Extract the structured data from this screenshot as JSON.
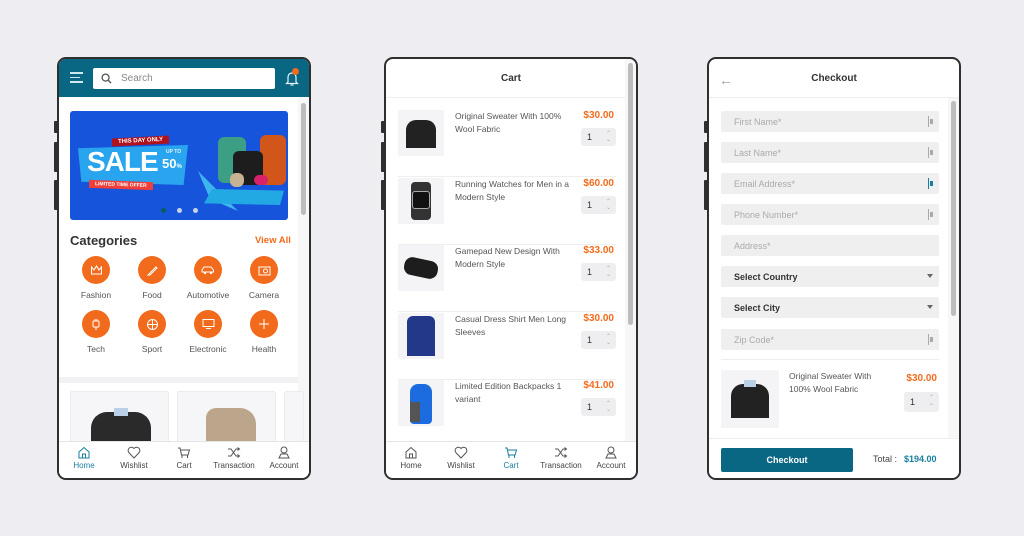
{
  "colors": {
    "primary": "#0a6783",
    "accent": "#f26b1d",
    "background": "#ededf2"
  },
  "home": {
    "search": {
      "placeholder": "Search",
      "icon": "search-icon"
    },
    "menu_icon": "menu-icon",
    "notification_icon": "bell-icon",
    "banner": {
      "tag": "THIS DAY ONLY",
      "headline": "SALE",
      "up_to": "UP TO",
      "discount": "50",
      "percent": "%",
      "sub": "LIMITED TIME OFFER",
      "active_slide": 1,
      "slide_count": 3
    },
    "categories_title": "Categories",
    "view_all": "View All",
    "categories": [
      {
        "label": "Fashion",
        "icon": "crown-icon"
      },
      {
        "label": "Food",
        "icon": "knife-icon"
      },
      {
        "label": "Automotive",
        "icon": "car-icon"
      },
      {
        "label": "Camera",
        "icon": "camera-icon"
      },
      {
        "label": "Tech",
        "icon": "plug-icon"
      },
      {
        "label": "Sport",
        "icon": "ball-icon"
      },
      {
        "label": "Electronic",
        "icon": "monitor-icon"
      },
      {
        "label": "Health",
        "icon": "plus-icon"
      }
    ]
  },
  "nav": [
    {
      "label": "Home",
      "icon": "home-icon"
    },
    {
      "label": "Wishlist",
      "icon": "heart-icon"
    },
    {
      "label": "Cart",
      "icon": "cart-icon"
    },
    {
      "label": "Transaction",
      "icon": "shuffle-icon"
    },
    {
      "label": "Account",
      "icon": "user-icon"
    }
  ],
  "cart": {
    "title": "Cart",
    "items": [
      {
        "name": "Original Sweater With 100% Wool Fabric",
        "price": "$30.00",
        "qty": "1",
        "image": "sweater"
      },
      {
        "name": "Running Watches for Men in a Modern Style",
        "price": "$60.00",
        "qty": "1",
        "image": "watch"
      },
      {
        "name": "Gamepad New Design With Modern Style",
        "price": "$33.00",
        "qty": "1",
        "image": "gamepad"
      },
      {
        "name": "Casual Dress Shirt Men Long Sleeves",
        "price": "$30.00",
        "qty": "1",
        "image": "shirt"
      },
      {
        "name": "Limited Edition Backpacks 1 variant",
        "price": "$41.00",
        "qty": "1",
        "image": "backpack"
      }
    ]
  },
  "checkout": {
    "title": "Checkout",
    "fields": {
      "first_name": "First Name*",
      "last_name": "Last Name*",
      "email": "Email Address*",
      "phone": "Phone Number*",
      "address": "Address*",
      "country": "Select Country",
      "city": "Select City",
      "zip": "Zip Code*"
    },
    "item": {
      "name": "Original Sweater With 100% Wool Fabric",
      "price": "$30.00",
      "qty": "1"
    },
    "button": "Checkout",
    "total_label": "Total :",
    "total_value": "$194.00"
  }
}
